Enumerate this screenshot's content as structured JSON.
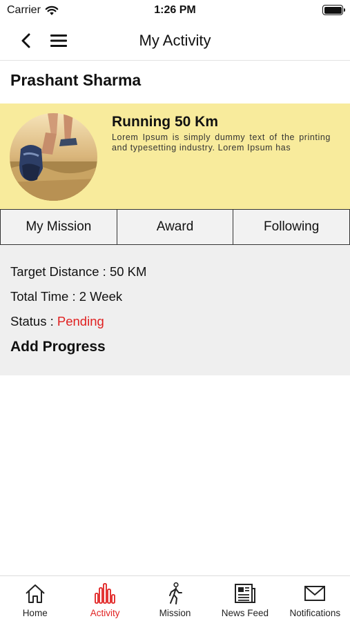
{
  "status_bar": {
    "carrier": "Carrier",
    "time": "1:26 PM"
  },
  "nav": {
    "title": "My Activity",
    "back_icon": "chevron-left-icon",
    "menu_icon": "hamburger-icon"
  },
  "user": {
    "name": "Prashant Sharma"
  },
  "activity": {
    "title": "Running 50 Km",
    "description": "Lorem Ipsum is simply dummy text of the printing and typesetting industry. Lorem Ipsum has"
  },
  "tabs": [
    {
      "label": "My Mission"
    },
    {
      "label": "Award"
    },
    {
      "label": "Following"
    }
  ],
  "details": {
    "target": "Target Distance : 50 KM",
    "time": "Total Time : 2 Week",
    "status_label": "Status : ",
    "status_value": "Pending",
    "add_progress": "Add Progress"
  },
  "bottom_tabs": [
    {
      "label": "Home",
      "icon": "home-icon"
    },
    {
      "label": "Activity",
      "icon": "activity-bars-icon",
      "active": true
    },
    {
      "label": "Mission",
      "icon": "walking-person-icon"
    },
    {
      "label": "News Feed",
      "icon": "newspaper-icon"
    },
    {
      "label": "Notifications",
      "icon": "envelope-icon"
    }
  ],
  "colors": {
    "card_bg": "#f8eb9c",
    "accent_red": "#e02020",
    "details_bg": "#efefef"
  }
}
